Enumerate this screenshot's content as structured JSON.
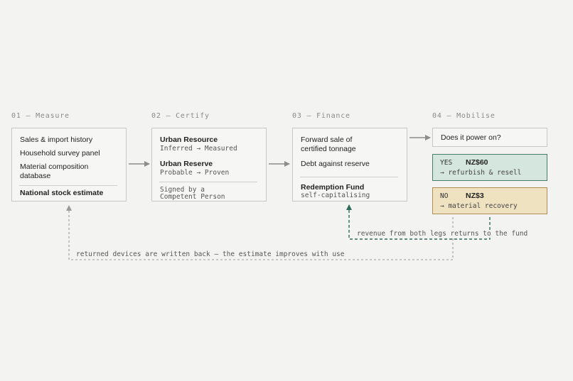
{
  "steps": [
    {
      "label": "01 — Measure",
      "items": [
        "Sales & import history",
        "Household survey panel",
        "Material composition",
        "database"
      ],
      "result": "National stock estimate"
    },
    {
      "label": "02 — Certify",
      "resource_title": "Urban Resource",
      "resource_sub": "Inferred → Measured",
      "reserve_title": "Urban Reserve",
      "reserve_sub": "Probable → Proven",
      "signed_line1": "Signed by a",
      "signed_line2": "Competent Person"
    },
    {
      "label": "03 — Finance",
      "forward_line1": "Forward sale of",
      "forward_line2": "certified tonnage",
      "debt": "Debt against reserve",
      "fund_title": "Redemption Fund",
      "fund_sub": "self-capitalising"
    },
    {
      "label": "04 — Mobilise",
      "question": "Does it power on?",
      "yes": {
        "tag": "YES",
        "amount": "NZ$60",
        "action": "→ refurbish & resell"
      },
      "no": {
        "tag": "NO",
        "amount": "NZ$3",
        "action": "→ material recovery"
      }
    }
  ],
  "notes": {
    "fund_return": "revenue from both legs returns to the fund",
    "writeback": "returned devices are written back — the estimate improves with use"
  },
  "colors": {
    "yes_border": "#4a7b6b",
    "yes_fill": "#d5e6df",
    "no_border": "#b18d53",
    "no_fill": "#efe2c1",
    "fund_loop": "#2f6b5a",
    "writeback_loop": "#9a9a9a"
  }
}
